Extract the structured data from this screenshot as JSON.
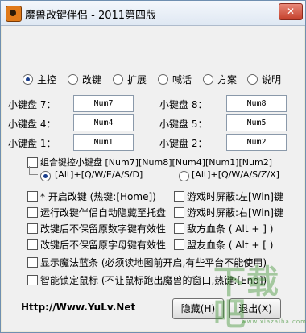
{
  "window": {
    "title": "魔兽改键伴侣 - 2011第四版"
  },
  "tabs": [
    {
      "label": "主控",
      "selected": true
    },
    {
      "label": "改键",
      "selected": false
    },
    {
      "label": "扩展",
      "selected": false
    },
    {
      "label": "喊话",
      "selected": false
    },
    {
      "label": "方案",
      "selected": false
    },
    {
      "label": "说明",
      "selected": false
    }
  ],
  "keypad": {
    "k7": {
      "label": "小键盘 7：",
      "value": "Num7"
    },
    "k4": {
      "label": "小键盘 4：",
      "value": "Num4"
    },
    "k1": {
      "label": "小键盘 1：",
      "value": "Num1"
    },
    "k8": {
      "label": "小键盘 8：",
      "value": "Num8"
    },
    "k5": {
      "label": "小键盘 5：",
      "value": "Num5"
    },
    "k2": {
      "label": "小键盘 2：",
      "value": "Num2"
    }
  },
  "combo": {
    "label": "组合键控小键盘 [Num7][Num8][Num4][Num1][Num2]",
    "opt1": "[Alt]+[Q/W/E/A/S/D]",
    "opt2": "[Alt]+[Q/W/A/S/Z/X]"
  },
  "options": {
    "o1": "* 开启改键 (热键:[Home])",
    "o2": "运行改键伴侣自动隐藏至托盘",
    "o3": "改键后不保留原数字键有效性",
    "o4": "改键后不保留原字母键有效性",
    "r1": "游戏时屏蔽:左[Win]键",
    "r2": "游戏时屏蔽:右[Win]键",
    "r3": "敌方血条 ( Alt + ] )",
    "r4": "盟友血条 ( Alt + [ )",
    "o5": "显示魔法蓝条 (必须读地图前开启,有些平台不能使用)",
    "o6": "智能锁定鼠标 (不让鼠标跑出魔兽的窗口,热键:[End])"
  },
  "footer": {
    "url": "Http://Www.YuLv.Net",
    "hide_label": "隐藏(H)",
    "exit_label": "退出(X)"
  },
  "watermark": {
    "text": "下载吧",
    "sub": "www.xiazaiba.com"
  }
}
